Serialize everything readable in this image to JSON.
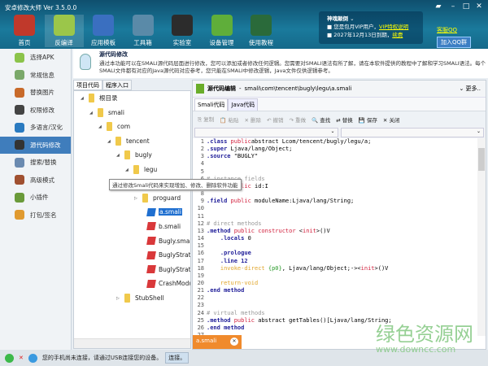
{
  "app": {
    "title": "安卓修改大师 Ver 3.5.0.0"
  },
  "toolbar": [
    {
      "label": "首页",
      "icon": "house-icon",
      "color": "#c0392b"
    },
    {
      "label": "反编译",
      "icon": "android-icon",
      "color": "#9bc64a",
      "active": true
    },
    {
      "label": "应用模板",
      "icon": "star-icon",
      "color": "#3a6fc0"
    },
    {
      "label": "工具箱",
      "icon": "toolbox-icon",
      "color": "#5a8aa8"
    },
    {
      "label": "实验室",
      "icon": "flask-icon",
      "color": "#2c2c2c"
    },
    {
      "label": "设备管理",
      "icon": "radar-icon",
      "color": "#5fae3a"
    },
    {
      "label": "使用教程",
      "icon": "blackboard-icon",
      "color": "#2a6a3a"
    }
  ],
  "vip": {
    "name": "神魂颠倒",
    "line1": "您是包月VIP用户，",
    "link1": "VIP特权说明",
    "line2": "2027年12月13日到期，",
    "link2": "续费"
  },
  "qq": {
    "service": "客服QQ",
    "group": "加入QQ群"
  },
  "sidebar": [
    {
      "label": "选择APK",
      "color": "#8bc34a"
    },
    {
      "label": "常规信息",
      "color": "#7aa86a"
    },
    {
      "label": "替换图片",
      "color": "#c86a2a"
    },
    {
      "label": "权限修改",
      "color": "#444"
    },
    {
      "label": "多语言/汉化",
      "color": "#2a7ac0"
    },
    {
      "label": "源代码修改",
      "color": "#333",
      "active": true
    },
    {
      "label": "搜索/替换",
      "color": "#6a8ab0"
    },
    {
      "label": "高级模式",
      "color": "#a05030"
    },
    {
      "label": "小插件",
      "color": "#6a9a3a"
    },
    {
      "label": "打包/签名",
      "color": "#e09a30"
    }
  ],
  "info": {
    "title": "源代码修改",
    "text": "通过本功能可以在SMALI源代码层面进行修改，您可以添加或者修改任何逻辑。您需要对SMALI语法有所了解，请在本软件提供的教程中了解和学习SMALI语法。每个SMALI文件都有对应的Java源代码对应参考，您只能在SMALI中修改逻辑，Java文件仅供逻辑参考。"
  },
  "project_tabs": [
    "项目代码",
    "程序入口"
  ],
  "tree": [
    {
      "label": "根目录",
      "depth": 0,
      "type": "folder"
    },
    {
      "label": "smali",
      "depth": 1,
      "type": "folder"
    },
    {
      "label": "com",
      "depth": 2,
      "type": "folder"
    },
    {
      "label": "tencent",
      "depth": 3,
      "type": "folder"
    },
    {
      "label": "bugly",
      "depth": 4,
      "type": "folder"
    },
    {
      "label": "legu",
      "depth": 5,
      "type": "folder"
    },
    {
      "label": "",
      "depth": 6,
      "type": "hidden"
    },
    {
      "label": "proguard",
      "depth": 6,
      "type": "folder",
      "collapsed": true
    },
    {
      "label": "a.smali",
      "depth": 6,
      "type": "file",
      "selected": true
    },
    {
      "label": "b.smali",
      "depth": 6,
      "type": "file"
    },
    {
      "label": "Bugly.smali",
      "depth": 6,
      "type": "file"
    },
    {
      "label": "BuglyStrategy",
      "depth": 6,
      "type": "file"
    },
    {
      "label": "BuglyStrategy",
      "depth": 6,
      "type": "file"
    },
    {
      "label": "CrashModule.",
      "depth": 6,
      "type": "file"
    },
    {
      "label": "StubShell",
      "depth": 4,
      "type": "folder",
      "collapsed": true
    }
  ],
  "tooltip": "通过修改Smali代码来实现增加、修改、删除软件功能",
  "editor": {
    "title": "源代码编辑",
    "path": "smali\\com\\tencent\\bugly\\legu\\a.smali",
    "more": "更多..",
    "tabs": [
      "Smali代码",
      "Java代码"
    ],
    "actions": [
      {
        "label": "复制",
        "enabled": false
      },
      {
        "label": "粘贴",
        "enabled": false
      },
      {
        "label": "删除",
        "enabled": false
      },
      {
        "label": "撤销",
        "enabled": false
      },
      {
        "label": "重做",
        "enabled": false
      },
      {
        "label": "查找",
        "enabled": true
      },
      {
        "label": "替换",
        "enabled": true
      },
      {
        "label": "保存",
        "enabled": true
      },
      {
        "label": "关闭",
        "enabled": true
      }
    ],
    "code": [
      [
        [
          "k",
          ".class "
        ],
        [
          "r",
          "public"
        ],
        [
          "",
          "abstract Lcom/tencent/bugly/legu/a;"
        ]
      ],
      [
        [
          "k",
          ".super "
        ],
        [
          "",
          "Ljava/lang/Object;"
        ]
      ],
      [
        [
          "k",
          ".source "
        ],
        [
          "",
          "\"BUGLY\""
        ]
      ],
      [],
      [],
      [
        [
          "c",
          "# instance fields"
        ]
      ],
      [
        [
          "k",
          ".field "
        ],
        [
          "r",
          "public "
        ],
        [
          "",
          "id:I"
        ]
      ],
      [],
      [
        [
          "k",
          ".field "
        ],
        [
          "r",
          "public "
        ],
        [
          "",
          "moduleName:Ljava/lang/String;"
        ]
      ],
      [],
      [],
      [
        [
          "c",
          "# direct methods"
        ]
      ],
      [
        [
          "k",
          ".method "
        ],
        [
          "r",
          "public constructor "
        ],
        [
          "",
          "<"
        ],
        [
          "r",
          "init"
        ],
        [
          "",
          ">()V"
        ]
      ],
      [
        [
          "k",
          "    .locals "
        ],
        [
          "",
          "0"
        ]
      ],
      [],
      [
        [
          "k",
          "    .prologue"
        ]
      ],
      [
        [
          "k",
          "    .line "
        ],
        [
          "k",
          "12"
        ]
      ],
      [
        [
          "o",
          "    invoke-direct "
        ],
        [
          "g",
          "{p0}"
        ],
        [
          "",
          ", Ljava/lang/Object;-><"
        ],
        [
          "r",
          "init"
        ],
        [
          "",
          ">()V"
        ]
      ],
      [],
      [
        [
          "o",
          "    return-void"
        ]
      ],
      [
        [
          "k",
          ".end method"
        ]
      ],
      [],
      [],
      [
        [
          "c",
          "# virtual methods"
        ]
      ],
      [
        [
          "k",
          ".method "
        ],
        [
          "r",
          "public "
        ],
        [
          "",
          "abstract getTables()[Ljava/lang/String;"
        ]
      ],
      [
        [
          "k",
          ".end method"
        ]
      ],
      []
    ],
    "file_tab": "a.smali"
  },
  "status": {
    "text": "您的手机尚未连接，请通过USB连接您的设备。",
    "connect": "连接。"
  },
  "watermark": {
    "cn": "绿色资源网",
    "url": "www.downcc.com"
  }
}
